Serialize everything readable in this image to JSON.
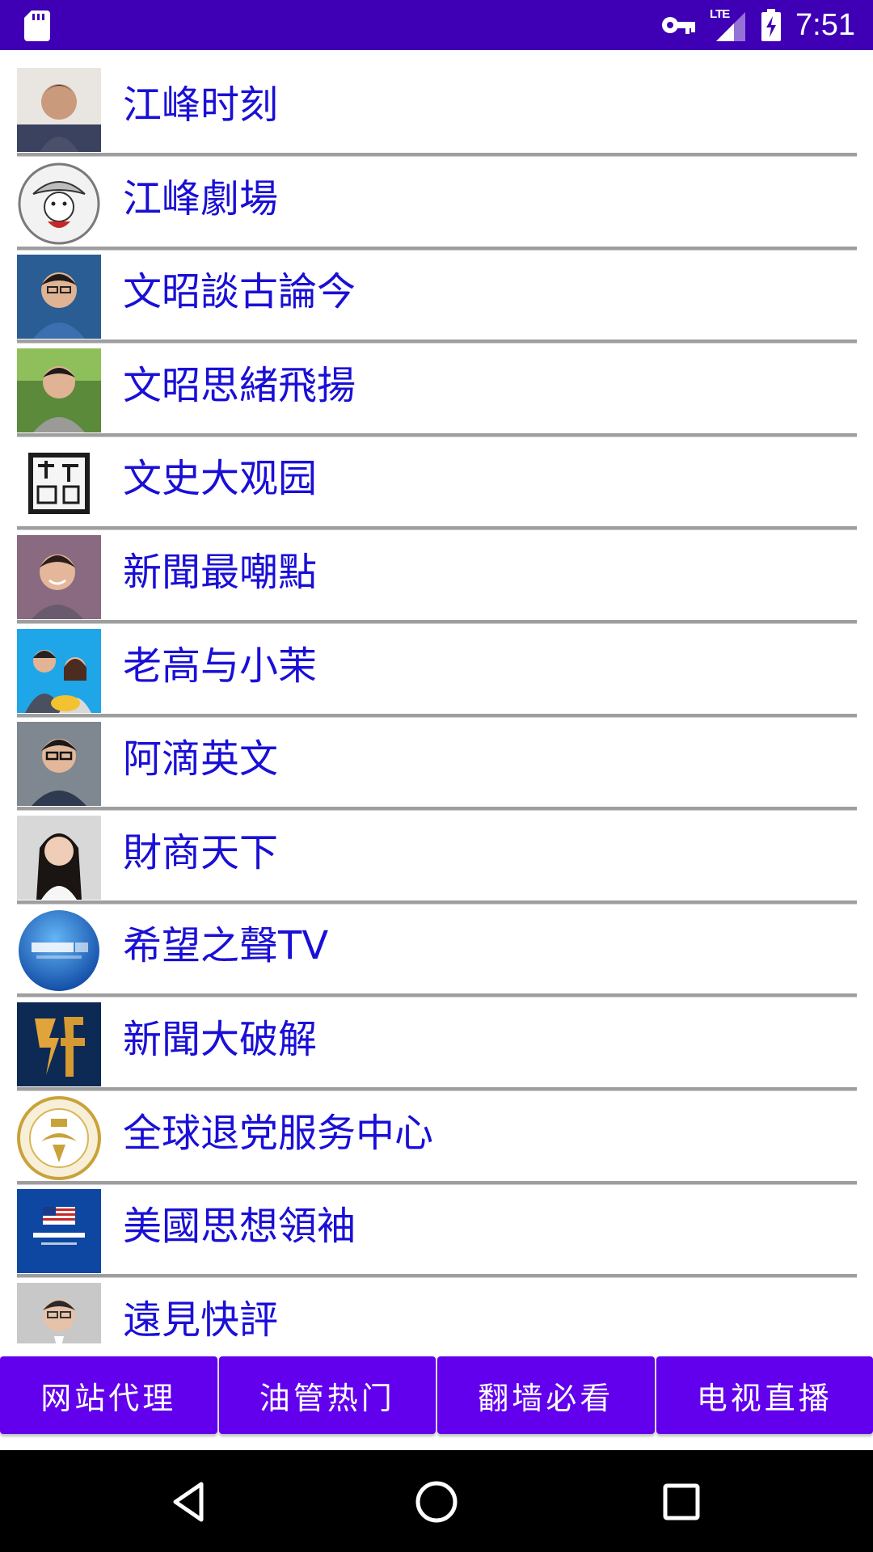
{
  "status_bar": {
    "time": "7:51",
    "network_label": "LTE",
    "icons": [
      "sd-card-icon",
      "vpn-key-icon",
      "lte-signal-icon",
      "battery-charging-icon"
    ],
    "background_color": "#3f00b5"
  },
  "channels": [
    {
      "label": "江峰时刻",
      "icon": "avatar-photo",
      "color": "#4a4f6a"
    },
    {
      "label": "江峰劇場",
      "icon": "cartoon-cowboy-badge",
      "color": "#e8e8e8"
    },
    {
      "label": "文昭談古論今",
      "icon": "avatar-photo",
      "color": "#2a5d93"
    },
    {
      "label": "文昭思緒飛揚",
      "icon": "avatar-photo",
      "color": "#5b8a3a"
    },
    {
      "label": "文史大观园",
      "icon": "calligraphy-seal",
      "color": "#222222"
    },
    {
      "label": "新聞最嘲點",
      "icon": "avatar-photo",
      "color": "#8a6a80"
    },
    {
      "label": "老高与小茉",
      "icon": "avatar-photo",
      "color": "#1fa6e8"
    },
    {
      "label": "阿滴英文",
      "icon": "avatar-photo",
      "color": "#7f8790"
    },
    {
      "label": "財商天下",
      "icon": "avatar-photo",
      "color": "#d8d8d8"
    },
    {
      "label": "希望之聲TV",
      "icon": "globe-logo",
      "color": "#1565c0"
    },
    {
      "label": "新聞大破解",
      "icon": "calligraphy-logo",
      "color": "#0d2a55"
    },
    {
      "label": "全球退党服务中心",
      "icon": "gold-seal-logo",
      "color": "#c9a23a"
    },
    {
      "label": "美國思想領袖",
      "icon": "flag-logo",
      "color": "#0d47a1"
    },
    {
      "label": "遠見快評",
      "icon": "avatar-photo",
      "color": "#c8c8c8"
    }
  ],
  "bottom_buttons": [
    {
      "label": "网站代理"
    },
    {
      "label": "油管热门"
    },
    {
      "label": "翻墙必看"
    },
    {
      "label": "电视直播"
    }
  ],
  "colors": {
    "accent": "#6200ee",
    "label_text": "#1a0fd6",
    "divider": "#9e9e9e"
  },
  "navigation": {
    "icons": [
      "back-icon",
      "home-icon",
      "recent-apps-icon"
    ]
  }
}
